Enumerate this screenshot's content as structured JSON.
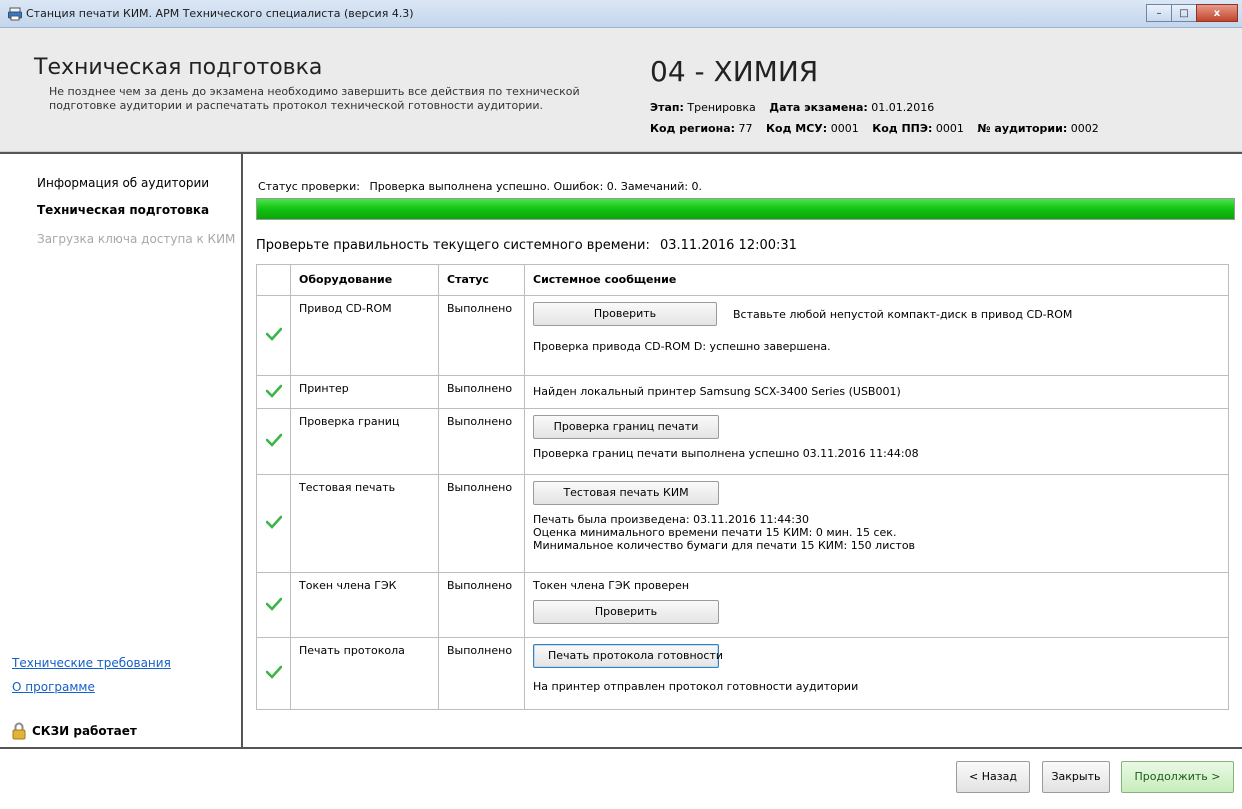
{
  "window": {
    "title": "Станция печати КИМ. АРМ Технического специалиста (версия 4.3)",
    "buttons": {
      "minimize": "–",
      "maximize": "□",
      "close": "x"
    }
  },
  "header": {
    "title": "Техническая подготовка",
    "description": "Не позднее чем за день до экзамена необходимо завершить все действия по технической подготовке аудитории и распечатать протокол технической готовности аудитории.",
    "subject": "04 - ХИМИЯ",
    "stage_label": "Этап:",
    "stage_value": "Тренировка",
    "exam_date_label": "Дата экзамена:",
    "exam_date_value": "01.01.2016",
    "region_label": "Код региона:",
    "region_value": "77",
    "msu_label": "Код МСУ:",
    "msu_value": "0001",
    "ppe_label": "Код ППЭ:",
    "ppe_value": "0001",
    "room_label": "№ аудитории:",
    "room_value": "0002"
  },
  "sidebar": {
    "items": [
      {
        "label": "Информация об аудитории",
        "state": "normal"
      },
      {
        "label": "Техническая подготовка",
        "state": "active"
      },
      {
        "label": "Загрузка ключа доступа к КИМ",
        "state": "disabled"
      }
    ],
    "links": [
      {
        "label": "Технические требования"
      },
      {
        "label": "О программе"
      }
    ],
    "crypto_status": "СКЗИ работает"
  },
  "main": {
    "status_label": "Статус проверки:",
    "status_text": "Проверка выполнена успешно. Ошибок: 0. Замечаний: 0.",
    "progress": 1.0,
    "time_label": "Проверьте правильность текущего системного времени:",
    "time_value": "03.11.2016 12:00:31",
    "table": {
      "headers": {
        "equipment": "Оборудование",
        "status": "Статус",
        "message": "Системное сообщение"
      },
      "rows": [
        {
          "equipment": "Привод CD-ROM",
          "status": "Выполнено",
          "button": "Проверить",
          "hint": "Вставьте любой непустой компакт-диск в привод CD-ROM",
          "message": "Проверка привода CD-ROM D: успешно завершена."
        },
        {
          "equipment": "Принтер",
          "status": "Выполнено",
          "message": "Найден локальный принтер Samsung SCX-3400 Series (USB001)"
        },
        {
          "equipment": "Проверка границ",
          "status": "Выполнено",
          "button": "Проверка границ печати",
          "message": "Проверка границ печати выполнена успешно 03.11.2016 11:44:08"
        },
        {
          "equipment": "Тестовая печать",
          "status": "Выполнено",
          "button": "Тестовая печать КИМ",
          "message_lines": [
            "Печать была произведена: 03.11.2016 11:44:30",
            "Оценка минимального времени печати 15 КИМ: 0 мин. 15 сек.",
            "Минимальное количество бумаги для печати 15 КИМ: 150 листов"
          ]
        },
        {
          "equipment": "Токен члена ГЭК",
          "status": "Выполнено",
          "message": "Токен члена ГЭК проверен",
          "button": "Проверить"
        },
        {
          "equipment": "Печать протокола",
          "status": "Выполнено",
          "button": "Печать протокола готовности",
          "message": "На принтер отправлен протокол готовности аудитории"
        }
      ]
    }
  },
  "footer": {
    "back": "< Назад",
    "close": "Закрыть",
    "continue": "Продолжить >"
  },
  "colors": {
    "progress": "#12c212",
    "check": "#3db54a",
    "link": "#1560c9",
    "lock": "#e2b23a"
  }
}
